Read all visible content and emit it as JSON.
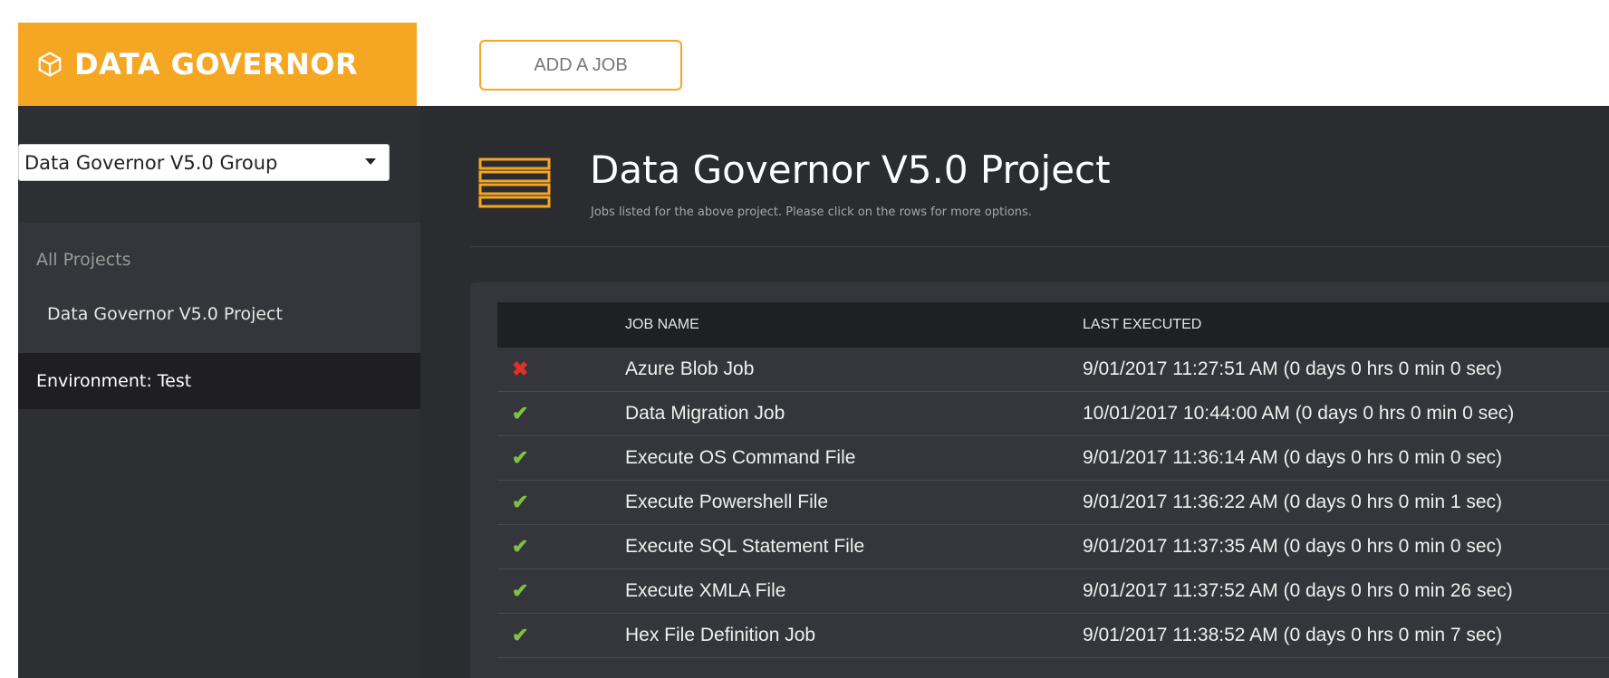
{
  "brand": {
    "name": "DATA GOVERNOR"
  },
  "toolbar": {
    "add_job_label": "ADD A JOB"
  },
  "sidebar": {
    "group_select_value": "Data Governor V5.0 Group",
    "all_projects_label": "All Projects",
    "project_item": "Data Governor V5.0 Project",
    "environment_label": "Environment: Test"
  },
  "project": {
    "title": "Data Governor V5.0 Project",
    "subtitle": "Jobs listed for the above project. Please click on the rows for more options."
  },
  "table": {
    "headers": [
      "",
      "JOB NAME",
      "LAST EXECUTED"
    ],
    "rows": [
      {
        "status": "fail",
        "status_glyph": "✖",
        "name": "Azure Blob Job",
        "last_executed": "9/01/2017 11:27:51 AM (0 days 0 hrs 0 min 0 sec)"
      },
      {
        "status": "ok",
        "status_glyph": "✔",
        "name": "Data Migration Job",
        "last_executed": "10/01/2017 10:44:00 AM (0 days 0 hrs 0 min 0 sec)"
      },
      {
        "status": "ok",
        "status_glyph": "✔",
        "name": "Execute OS Command File",
        "last_executed": "9/01/2017 11:36:14 AM (0 days 0 hrs 0 min 0 sec)"
      },
      {
        "status": "ok",
        "status_glyph": "✔",
        "name": "Execute Powershell File",
        "last_executed": "9/01/2017 11:36:22 AM (0 days 0 hrs 0 min 1 sec)"
      },
      {
        "status": "ok",
        "status_glyph": "✔",
        "name": "Execute SQL Statement File",
        "last_executed": "9/01/2017 11:37:35 AM (0 days 0 hrs 0 min 0 sec)"
      },
      {
        "status": "ok",
        "status_glyph": "✔",
        "name": "Execute XMLA File",
        "last_executed": "9/01/2017 11:37:52 AM (0 days 0 hrs 0 min 26 sec)"
      },
      {
        "status": "ok",
        "status_glyph": "✔",
        "name": "Hex File Definition Job",
        "last_executed": "9/01/2017 11:38:52 AM (0 days 0 hrs 0 min 7 sec)"
      }
    ]
  },
  "colors": {
    "brand_orange": "#f5a623",
    "sidebar_bg": "#2e2f33",
    "main_bg": "#2b2c30",
    "success_green": "#7ec242",
    "fail_red": "#e0302a"
  },
  "icons": {
    "brand": "cube-icon",
    "project": "list-bars-icon",
    "dropdown": "caret-down-icon",
    "success": "checkmark-icon",
    "fail": "cross-icon"
  }
}
